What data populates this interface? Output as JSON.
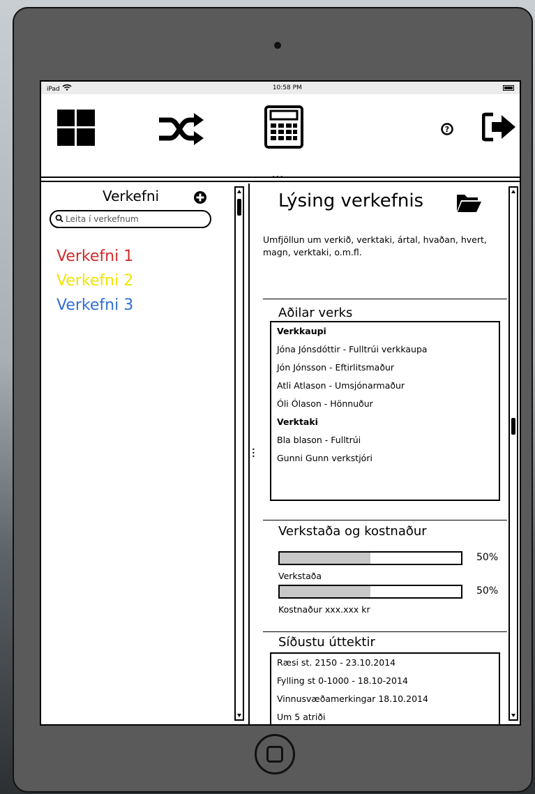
{
  "status": {
    "device": "iPad",
    "time": "10:58 PM"
  },
  "toolbar": {
    "icons": [
      "windows-icon",
      "shuffle-icon",
      "calculator-icon",
      "help-icon",
      "logout-icon"
    ]
  },
  "sidebar": {
    "title": "Verkefni",
    "search_placeholder": "Leita í verkefnum",
    "projects": [
      {
        "label": "Verkefni 1",
        "color": "#d42a2a"
      },
      {
        "label": "Verkefni 2",
        "color": "#f2e300"
      },
      {
        "label": "Verkefni 3",
        "color": "#2f6fd6"
      }
    ]
  },
  "main": {
    "title": "Lýsing verkefnis",
    "description": "Umfjöllun um verkið, verktaki, ártal, hvaðan, hvert, magn, verktaki, o.m.fl.",
    "parties": {
      "heading": "Aðilar verks",
      "rows": [
        {
          "text": "Verkkaupi",
          "bold": true
        },
        {
          "text": "Jóna Jónsdóttir - Fulltrúi verkkaupa",
          "bold": false
        },
        {
          "text": "Jón Jónsson - Eftirlitsmaður",
          "bold": false
        },
        {
          "text": "Atli Atlason - Umsjónarmaður",
          "bold": false
        },
        {
          "text": "Óli Ólason - Hönnuður",
          "bold": false
        },
        {
          "text": "Verktaki",
          "bold": true
        },
        {
          "text": "Bla blason - Fulltrúi",
          "bold": false
        },
        {
          "text": "Gunni Gunn verkstjóri",
          "bold": false
        }
      ]
    },
    "status": {
      "heading": "Verkstaða og kostnaður",
      "progress_label": "Verkstaða",
      "progress_value": 0.5,
      "progress_pct": "50%",
      "cost_label": "Kostnaður xxx.xxx kr",
      "cost_value": 0.5,
      "cost_pct": "50%"
    },
    "inspections": {
      "heading": "Síðustu úttektir",
      "rows": [
        "Ræsi st. 2150 - 23.10.2014",
        "Fylling st 0-1000 - 18.10-2014",
        "Vinnusvæðamerkingar 18.10.2014",
        "Um 5 atriði"
      ]
    }
  }
}
